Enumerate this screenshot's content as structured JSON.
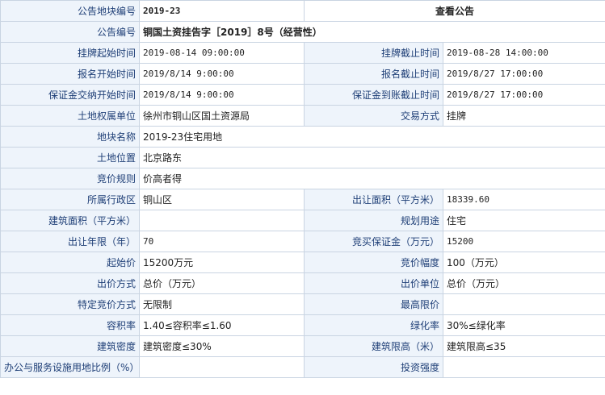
{
  "header": {
    "label": "公告地块编号",
    "value": "2019-23",
    "link": "查看公告"
  },
  "notice": {
    "label": "公告编号",
    "value": "铜国土资挂告字［2019］8号（经营性）"
  },
  "rows": [
    {
      "l1": "挂牌起始时间",
      "v1": "2019-08-14 09:00:00",
      "l2": "挂牌截止时间",
      "v2": "2019-08-28 14:00:00"
    },
    {
      "l1": "报名开始时间",
      "v1": "2019/8/14 9:00:00",
      "l2": "报名截止时间",
      "v2": "2019/8/27 17:00:00"
    },
    {
      "l1": "保证金交纳开始时间",
      "v1": "2019/8/14 9:00:00",
      "l2": "保证金到账截止时间",
      "v2": "2019/8/27 17:00:00"
    },
    {
      "l1": "土地权属单位",
      "v1": "徐州市铜山区国土资源局",
      "l2": "交易方式",
      "v2": "挂牌"
    }
  ],
  "full_rows": [
    {
      "l": "地块名称",
      "v": "2019-23住宅用地"
    },
    {
      "l": "土地位置",
      "v": "北京路东"
    },
    {
      "l": "竞价规则",
      "v": "价高者得"
    }
  ],
  "rows2": [
    {
      "l1": "所属行政区",
      "v1": "铜山区",
      "l2": "出让面积（平方米）",
      "v2": "18339.60"
    },
    {
      "l1": "建筑面积（平方米）",
      "v1": "",
      "l2": "规划用途",
      "v2": "住宅"
    },
    {
      "l1": "出让年限（年）",
      "v1": "70",
      "l2": "竞买保证金（万元）",
      "v2": "15200"
    },
    {
      "l1": "起始价",
      "v1": "15200万元",
      "l2": "竞价幅度",
      "v2": "100（万元）"
    },
    {
      "l1": "出价方式",
      "v1": "总价（万元）",
      "l2": "出价单位",
      "v2": "总价（万元）"
    },
    {
      "l1": "特定竞价方式",
      "v1": "无限制",
      "l2": "最高限价",
      "v2": ""
    },
    {
      "l1": "容积率",
      "v1": "1.40≤容积率≤1.60",
      "l2": "绿化率",
      "v2": "30%≤绿化率"
    },
    {
      "l1": "建筑密度",
      "v1": "建筑密度≤30%",
      "l2": "建筑限高（米）",
      "v2": "建筑限高≤35"
    },
    {
      "l1": "办公与服务设施用地比例（%）",
      "v1": "",
      "l2": "投资强度",
      "v2": ""
    }
  ]
}
